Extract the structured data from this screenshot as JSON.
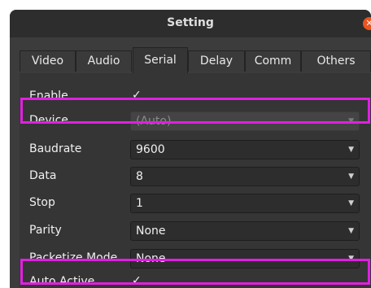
{
  "window": {
    "title": "Setting"
  },
  "tabs": [
    "Video",
    "Audio",
    "Serial",
    "Delay",
    "Comm",
    "Others"
  ],
  "settings": {
    "enable": {
      "label": "Enable",
      "checked_glyph": "✓"
    },
    "device": {
      "label": "Device",
      "value": "(Auto)"
    },
    "baudrate": {
      "label": "Baudrate",
      "value": "9600"
    },
    "data": {
      "label": "Data",
      "value": "8"
    },
    "stop": {
      "label": "Stop",
      "value": "1"
    },
    "parity": {
      "label": "Parity",
      "value": "None"
    },
    "packetize": {
      "label": "Packetize Mode",
      "value": "None"
    },
    "auto_active": {
      "label": "Auto Active",
      "checked_glyph": "✓"
    }
  },
  "icons": {
    "close": "close-icon",
    "dropdown": "chevron-down-icon",
    "check": "check-icon"
  },
  "colors": {
    "highlight": "#e020e0",
    "close_button": "#e95420"
  }
}
